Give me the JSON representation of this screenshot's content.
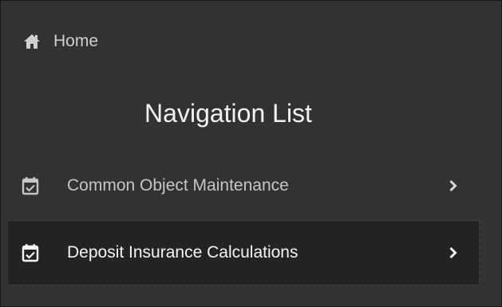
{
  "home": {
    "label": "Home",
    "icon": "home-icon"
  },
  "navigation": {
    "title": "Navigation List",
    "items": [
      {
        "label": "Common Object Maintenance",
        "icon": "calendar-check-icon",
        "expand_icon": "chevron-right-icon",
        "selected": false
      },
      {
        "label": "Deposit Insurance Calculations",
        "icon": "calendar-check-icon",
        "expand_icon": "chevron-right-icon",
        "selected": true
      }
    ]
  },
  "colors": {
    "background": "#323232",
    "selected_background": "#232323",
    "text": "#c6c6c6",
    "text_selected": "#f4f4f4"
  }
}
